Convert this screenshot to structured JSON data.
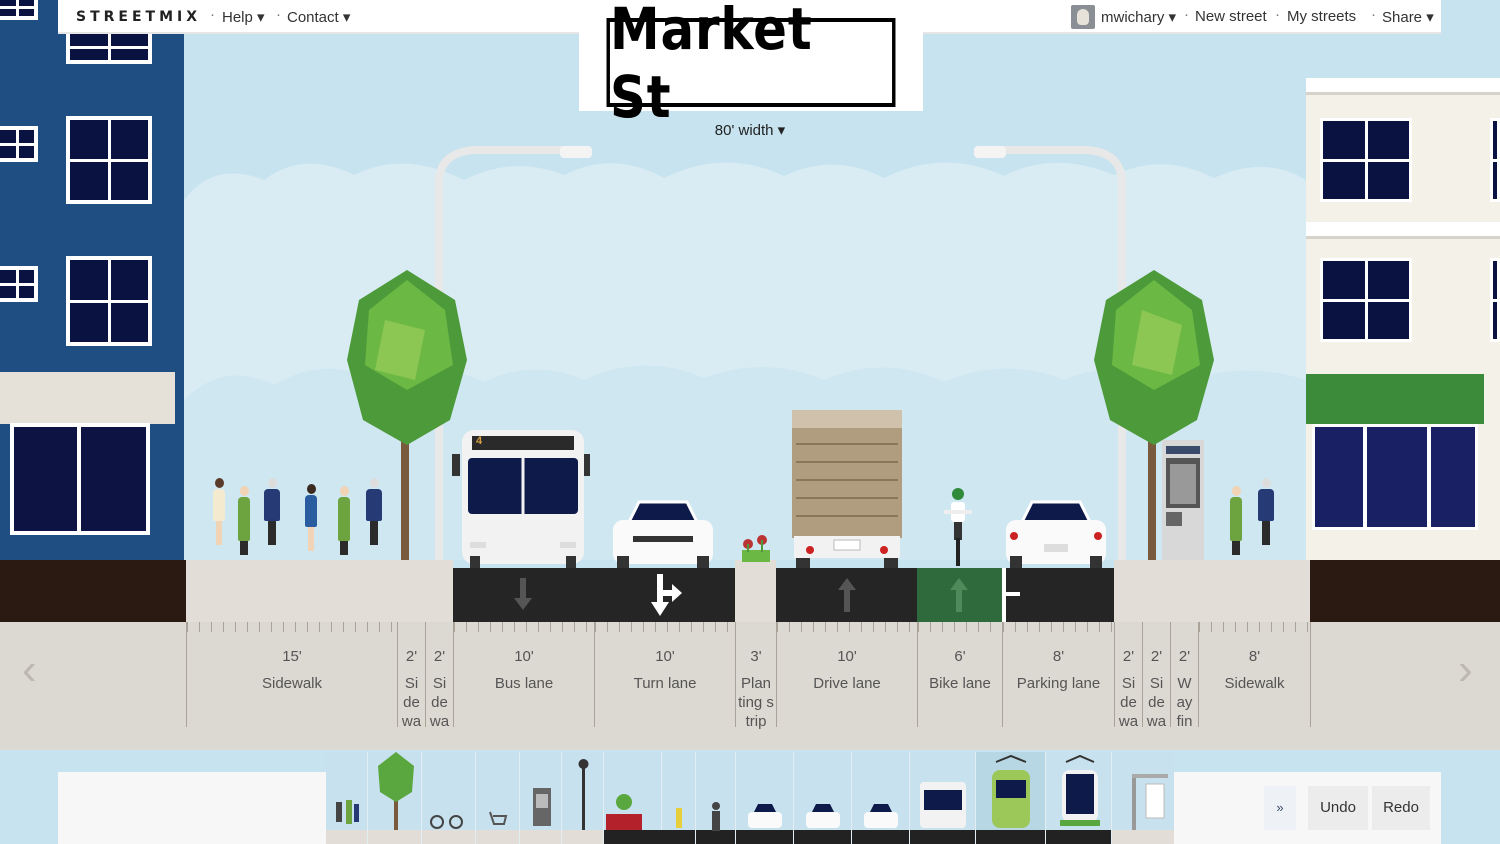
{
  "topbar": {
    "logo": "STREETMIX",
    "help": "Help ▾",
    "contact": "Contact ▾",
    "user": "mwichary ▾",
    "new_street": "New street",
    "my_streets": "My streets",
    "share": "Share ▾",
    "dot": "·"
  },
  "street": {
    "name": "Market St",
    "width": "80' width ▾"
  },
  "segments": [
    {
      "width": "15'",
      "name": "Sidewalk"
    },
    {
      "width": "2'",
      "name": "Si de wa"
    },
    {
      "width": "2'",
      "name": "Si de wa"
    },
    {
      "width": "10'",
      "name": "Bus lane"
    },
    {
      "width": "10'",
      "name": "Turn lane"
    },
    {
      "width": "3'",
      "name": "Plan ting strip"
    },
    {
      "width": "10'",
      "name": "Drive lane"
    },
    {
      "width": "6'",
      "name": "Bike lane"
    },
    {
      "width": "8'",
      "name": "Parking lane"
    },
    {
      "width": "2'",
      "name": "Si de wa"
    },
    {
      "width": "2'",
      "name": "Si de wa"
    },
    {
      "width": "2'",
      "name": "W ay fin"
    },
    {
      "width": "8'",
      "name": "Sidewalk"
    }
  ],
  "controls": {
    "more": "»",
    "undo": "Undo",
    "redo": "Redo",
    "left_arrow": "‹",
    "right_arrow": "›"
  },
  "bus_route": "4",
  "colors": {
    "building_left": "#1f4e83",
    "sky": "#c6e3ef",
    "lane": "#252525",
    "bike_lane": "#2f6a3c",
    "awning_right": "#3b8b3a"
  },
  "palette_items": [
    "pedestrians",
    "tree",
    "bike-rack",
    "shopping-cart",
    "newspaper-box",
    "lamp-post",
    "planter",
    "hydrant",
    "cyclist",
    "car",
    "car-turn",
    "car-small",
    "bus",
    "streetcar-green",
    "streetcar-blue",
    "bus-shelter"
  ]
}
